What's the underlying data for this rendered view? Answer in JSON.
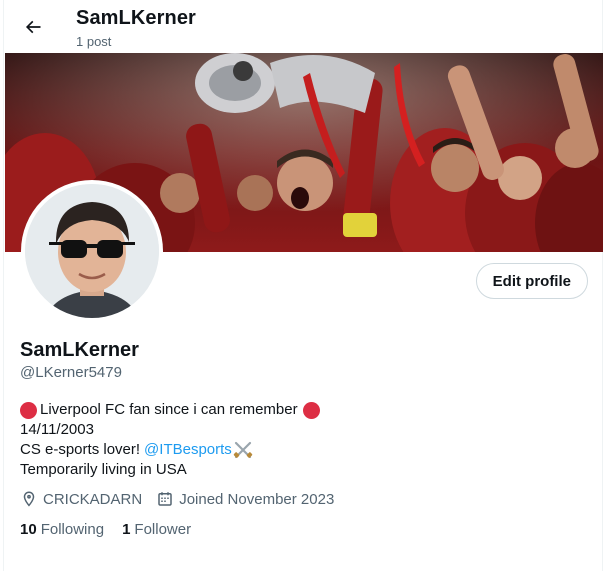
{
  "header": {
    "title": "SamLKerner",
    "post_count": "1 post"
  },
  "icons": {
    "back": "arrow-left-icon",
    "location": "location-pin-icon",
    "calendar": "calendar-icon",
    "bio_emoji_circle": "red-circle-emoji",
    "bio_emoji_swords": "crossed-swords-emoji"
  },
  "profile": {
    "display_name": "SamLKerner",
    "handle": "@LKerner5479",
    "edit_button": "Edit profile",
    "bio": {
      "line1": "Liverpool FC fan since i can remember",
      "line2": "14/11/2003",
      "line3_prefix": "CS e-sports lover!",
      "line3_mention": "@ITBesports",
      "line4": "Temporarily living in USA"
    },
    "location": "CRICKADARN",
    "joined": "Joined November 2023",
    "following_count": "10",
    "following_label": "Following",
    "followers_count": "1",
    "followers_label": "Follower"
  },
  "colors": {
    "link": "#1d9bf0",
    "secondary_text": "#536471",
    "emoji_red": "#dd2e44"
  }
}
